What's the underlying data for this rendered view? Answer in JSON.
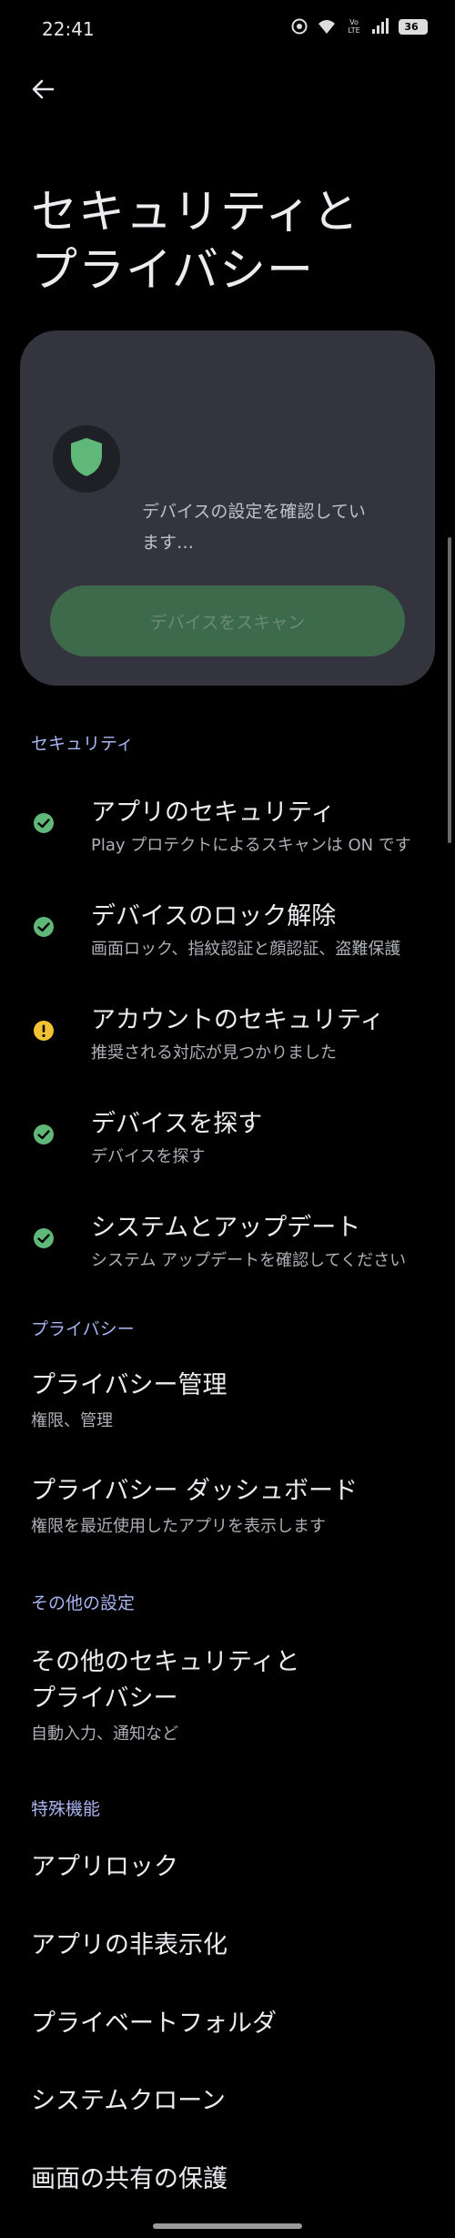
{
  "status_bar": {
    "time": "22:41",
    "network_label": "Vo LTE",
    "battery": "36"
  },
  "page": {
    "title_line1": "セキュリティと",
    "title_line2": "プライバシー"
  },
  "scan_card": {
    "status_line1": "デバイスの設定を確認してい",
    "status_line2": "ます…",
    "scan_button_label": "デバイスをスキャン",
    "shield_color": "#5fb878"
  },
  "security": {
    "header": "セキュリティ",
    "items": [
      {
        "title": "アプリのセキュリティ",
        "subtitle": "Play プロテクトによるスキャンは ON です",
        "status_icon": "check-circle-icon"
      },
      {
        "title": "デバイスのロック解除",
        "subtitle": "画面ロック、指紋認証と顔認証、盗難保護",
        "status_icon": "check-circle-icon"
      },
      {
        "title": "アカウントのセキュリティ",
        "subtitle": "推奨される対応が見つかりました",
        "status_icon": "warning-circle-icon"
      },
      {
        "title": "デバイスを探す",
        "subtitle": "デバイスを探す",
        "status_icon": "check-circle-icon"
      },
      {
        "title": "システムとアップデート",
        "subtitle": "システム アップデートを確認してください",
        "status_icon": "check-circle-icon"
      }
    ]
  },
  "privacy": {
    "header": "プライバシー",
    "items": [
      {
        "title": "プライバシー管理",
        "subtitle": "権限、管理"
      },
      {
        "title": "プライバシー ダッシュボード",
        "subtitle": "権限を最近使用したアプリを表示します"
      }
    ]
  },
  "other": {
    "header": "その他の設定",
    "item_title_line1": "その他のセキュリティと",
    "item_title_line2": "プライバシー",
    "item_subtitle": "自動入力、通知など"
  },
  "special": {
    "header": "特殊機能",
    "items": [
      {
        "title": "アプリロック"
      },
      {
        "title": "アプリの非表示化"
      },
      {
        "title": "プライベートフォルダ"
      },
      {
        "title": "システムクローン"
      },
      {
        "title": "画面の共有の保護"
      }
    ]
  },
  "colors": {
    "ok": "#5fb878",
    "warning": "#f2c230",
    "accent": "#a8b4f0",
    "card": "#33343d",
    "button": "#3c6a4b"
  }
}
